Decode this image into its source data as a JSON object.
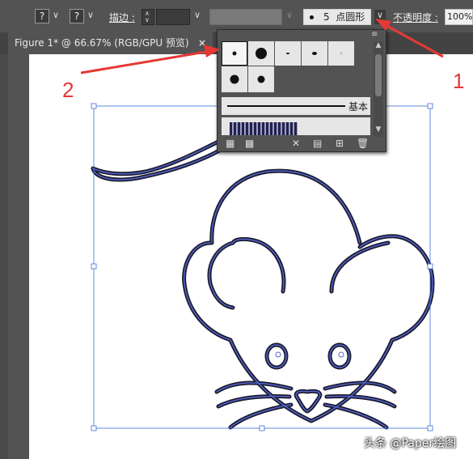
{
  "toolbar": {
    "fill_swatch": "?",
    "stroke_swatch": "?",
    "stroke_label": "描边 :",
    "brush_size": "5",
    "brush_shape": "点圆形",
    "opacity_label": "不透明度 :",
    "opacity_value": "100%"
  },
  "document_tab": {
    "title": "Figure 1* @ 66.67% (RGB/GPU 预览)",
    "close": "×"
  },
  "brush_panel": {
    "basic_label": "基本",
    "brushes": [
      {
        "name": "5 pt round",
        "selected": true
      },
      {
        "name": "large round"
      },
      {
        "name": "tiny calligraphic"
      },
      {
        "name": "calligraphic oval"
      },
      {
        "name": "thin"
      },
      {
        "name": "round medium"
      },
      {
        "name": "round small"
      }
    ],
    "icons": [
      "library-icon",
      "brush-libraries-icon",
      "remove-stroke-icon",
      "options-icon",
      "new-brush-icon",
      "delete-icon"
    ]
  },
  "annotations": {
    "label_1": "1",
    "label_2": "2",
    "arrow_color": "#e53935"
  },
  "watermark": "头条 @Paper绘图",
  "colors": {
    "stroke_outer": "#1a1a2e",
    "stroke_inner": "#5566cc",
    "selection": "#3b6fd6"
  }
}
